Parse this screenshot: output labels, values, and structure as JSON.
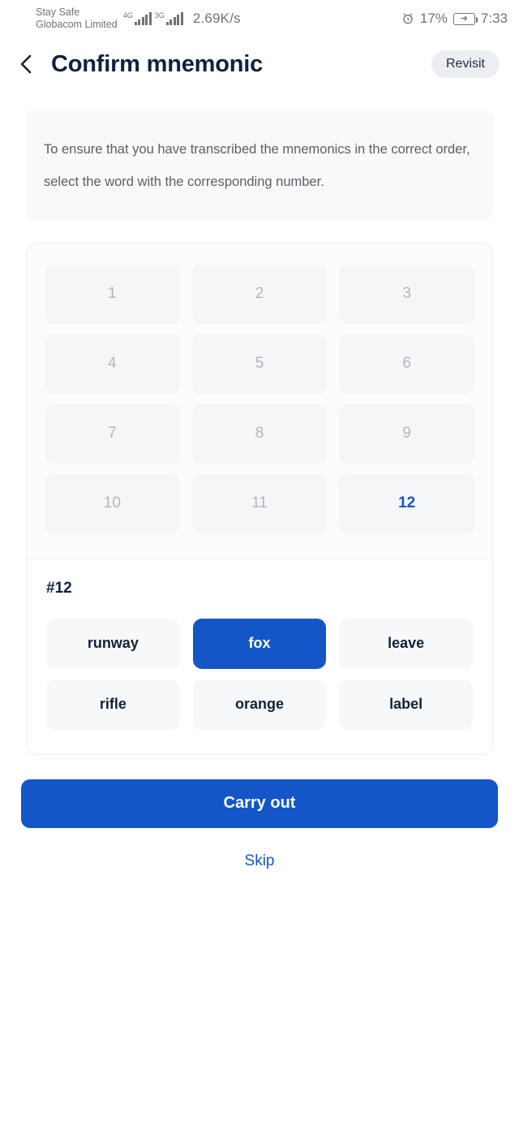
{
  "status_bar": {
    "carrier_line1": "Stay Safe",
    "carrier_line2": "Globacom Limited",
    "sim1_network": "4G",
    "sim2_network": "3G",
    "network_speed": "2.69K/s",
    "battery_percent": "17%",
    "time": "7:33",
    "alarm_icon": "alarm-clock-icon",
    "battery_icon": "battery-charging-icon"
  },
  "header": {
    "back_icon": "chevron-left-icon",
    "title": "Confirm mnemonic",
    "revisit_label": "Revisit"
  },
  "instructions": {
    "text": "To ensure that you have transcribed the mnemonics in the correct order, select the word with the corresponding number."
  },
  "number_grid": {
    "cells": [
      {
        "label": "1",
        "selected": false
      },
      {
        "label": "2",
        "selected": false
      },
      {
        "label": "3",
        "selected": false
      },
      {
        "label": "4",
        "selected": false
      },
      {
        "label": "5",
        "selected": false
      },
      {
        "label": "6",
        "selected": false
      },
      {
        "label": "7",
        "selected": false
      },
      {
        "label": "8",
        "selected": false
      },
      {
        "label": "9",
        "selected": false
      },
      {
        "label": "10",
        "selected": false
      },
      {
        "label": "11",
        "selected": false
      },
      {
        "label": "12",
        "selected": true
      }
    ],
    "selected_index": 11
  },
  "word_section": {
    "index_label": "#12",
    "options": [
      {
        "label": "runway",
        "selected": false
      },
      {
        "label": "fox",
        "selected": true
      },
      {
        "label": "leave",
        "selected": false
      },
      {
        "label": "rifle",
        "selected": false
      },
      {
        "label": "orange",
        "selected": false
      },
      {
        "label": "label",
        "selected": false
      }
    ]
  },
  "actions": {
    "primary_label": "Carry out",
    "skip_label": "Skip"
  },
  "colors": {
    "accent": "#1456c8",
    "title": "#0e2340",
    "muted_text": "#b2b8bf",
    "body_text": "#5b6066",
    "tile_bg": "#f5f6f8",
    "panel_bg": "#f8f9fa",
    "chip_bg": "#eceef1"
  }
}
